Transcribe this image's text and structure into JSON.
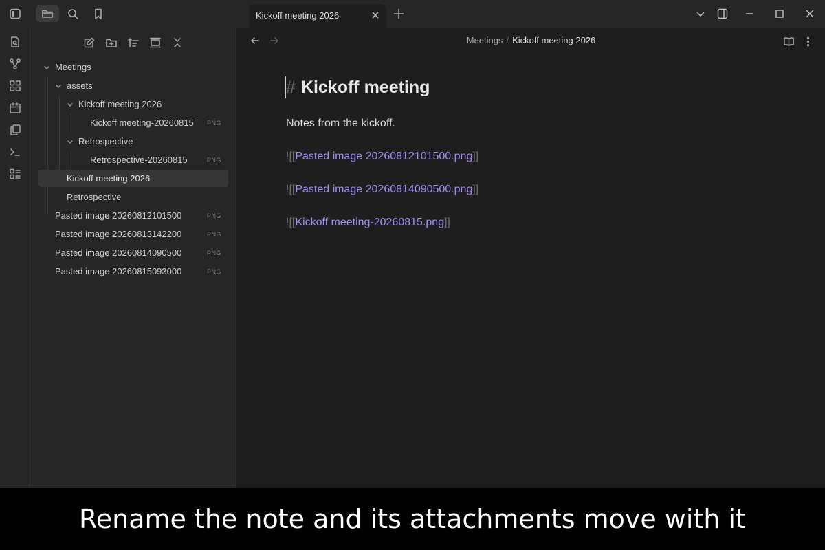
{
  "tab": {
    "title": "Kickoff meeting 2026"
  },
  "colors": {
    "accent_link": "#a68af9",
    "background": "#1e1e1e",
    "sidebar": "#262626",
    "caption_bg": "#000000"
  },
  "titlebar_icons": [
    "sidebar-toggle-icon",
    "folder-icon",
    "search-icon",
    "bookmark-icon",
    "chevron-down-icon",
    "right-sidebar-icon",
    "minimize-icon",
    "maximize-icon",
    "close-icon"
  ],
  "ribbon_icons": [
    "quick-switcher-icon",
    "graph-icon",
    "canvas-icon",
    "calendar-icon",
    "templates-icon",
    "terminal-icon",
    "command-palette-icon"
  ],
  "explorer": {
    "toolbar_icons": [
      "new-note-icon",
      "new-folder-icon",
      "sort-icon",
      "collapse-icon",
      "expand-collapse-icon"
    ],
    "tree": [
      {
        "label": "Meetings",
        "ext": ""
      },
      {
        "label": "assets",
        "ext": ""
      },
      {
        "label": "Kickoff meeting 2026",
        "ext": ""
      },
      {
        "label": "Kickoff meeting-20260815",
        "ext": "PNG"
      },
      {
        "label": "Retrospective",
        "ext": ""
      },
      {
        "label": "Retrospective-20260815",
        "ext": "PNG"
      },
      {
        "label": "Kickoff meeting 2026",
        "ext": ""
      },
      {
        "label": "Retrospective",
        "ext": ""
      },
      {
        "label": "Pasted image 20260812101500",
        "ext": "PNG"
      },
      {
        "label": "Pasted image 20260813142200",
        "ext": "PNG"
      },
      {
        "label": "Pasted image 20260814090500",
        "ext": "PNG"
      },
      {
        "label": "Pasted image 20260815093000",
        "ext": "PNG"
      }
    ]
  },
  "editor": {
    "breadcrumb": {
      "folder": "Meetings",
      "separator": "/",
      "note": "Kickoff meeting 2026"
    },
    "heading_marker": "#",
    "heading": "Kickoff meeting",
    "paragraph": "Notes from the kickoff.",
    "embeds": [
      {
        "open": "![[",
        "target": "Pasted image 20260812101500.png",
        "close": "]]"
      },
      {
        "open": "![[",
        "target": "Pasted image 20260814090500.png",
        "close": "]]"
      },
      {
        "open": "![[",
        "target": "Kickoff meeting-20260815.png",
        "close": "]]"
      }
    ]
  },
  "caption": "Rename the note and its attachments move with it"
}
